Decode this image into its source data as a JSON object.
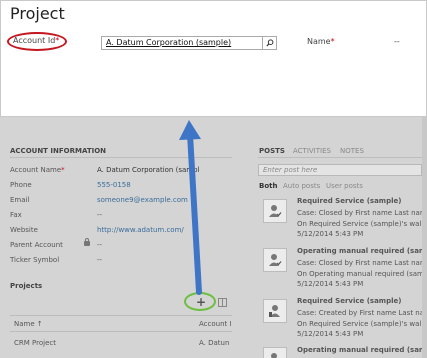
{
  "quick_create": {
    "title": "Project",
    "account_label": "Account Id",
    "required_mark": "*",
    "account_value": "A. Datum Corporation (sample)",
    "name_label": "Name",
    "name_value": "--"
  },
  "account_info": {
    "heading": "ACCOUNT INFORMATION",
    "fields": [
      {
        "label": "Account Name",
        "value": "A. Datum Corporation (sampl"
      },
      {
        "label": "Phone",
        "value": "555-0158"
      },
      {
        "label": "Email",
        "value": "someone9@example.com"
      },
      {
        "label": "Fax",
        "value": "--"
      },
      {
        "label": "Website",
        "value": "http://www.adatum.com/"
      },
      {
        "label": "Parent Account",
        "value": "--"
      },
      {
        "label": "Ticker Symbol",
        "value": "--"
      }
    ]
  },
  "projects": {
    "heading": "Projects",
    "col_name": "Name",
    "col_account": "Account I",
    "row_name": "CRM Project",
    "row_account": "A. Datun"
  },
  "posts": {
    "tabs": [
      "POSTS",
      "ACTIVITIES",
      "NOTES"
    ],
    "placeholder": "Enter post here",
    "filters": [
      "Both",
      "Auto posts",
      "User posts"
    ],
    "items": [
      {
        "title": "Required Service (sample)",
        "line1": "Case: Closed by First name Last name fe",
        "line2": "On Required Service (sample)'s wall",
        "date": "5/12/2014 5:43 PM"
      },
      {
        "title": "Operating manual required (sample)",
        "line1": "Case: Closed by First name Last name fe",
        "line2": "On Operating manual required (sample)",
        "date": "5/12/2014 5:43 PM"
      },
      {
        "title": "Required Service (sample)",
        "line1": "Case: Created by First name Last name f",
        "line2": "On Required Service (sample)'s wall",
        "date": "5/12/2014 5:43 PM"
      },
      {
        "title": "Operating manual required (sample)",
        "line1": "",
        "line2": "",
        "date": ""
      }
    ]
  },
  "colors": {
    "accent_link": "#3a6d99",
    "annotation_red": "#c4171f",
    "annotation_green": "#6cbf3e",
    "annotation_arrow": "#3e75c6"
  }
}
